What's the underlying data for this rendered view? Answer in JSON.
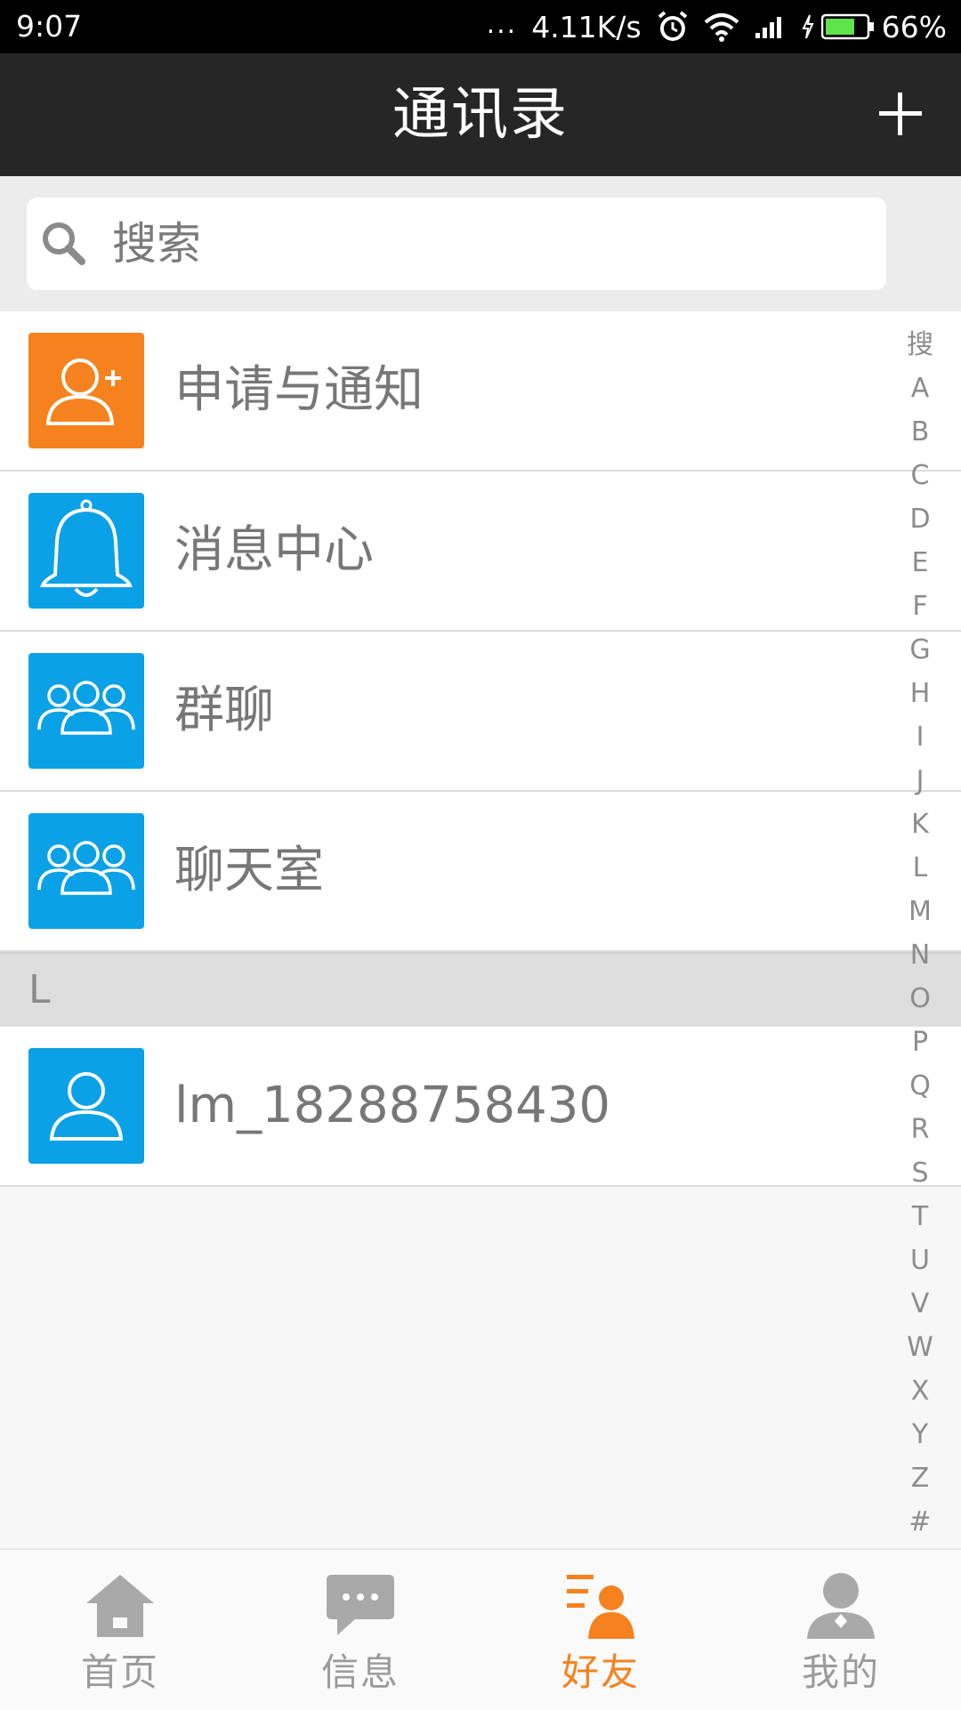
{
  "status_bar": {
    "time": "9:07",
    "dots": "...",
    "speed": "4.11K/s",
    "battery": "66%"
  },
  "header": {
    "title": "通讯录"
  },
  "search": {
    "placeholder": "搜索"
  },
  "list": {
    "items": [
      {
        "label": "申请与通知",
        "icon": "add-user-icon",
        "color": "#f5821f"
      },
      {
        "label": "消息中心",
        "icon": "bell-icon",
        "color": "#0aa1e6"
      },
      {
        "label": "群聊",
        "icon": "group-icon",
        "color": "#0aa1e6"
      },
      {
        "label": "聊天室",
        "icon": "group-icon",
        "color": "#0aa1e6"
      }
    ],
    "section_letter": "L",
    "contact": {
      "label": "lm_18288758430",
      "icon": "user-icon",
      "color": "#0aa1e6"
    }
  },
  "alphabet": [
    "搜",
    "A",
    "B",
    "C",
    "D",
    "E",
    "F",
    "G",
    "H",
    "I",
    "J",
    "K",
    "L",
    "M",
    "N",
    "O",
    "P",
    "Q",
    "R",
    "S",
    "T",
    "U",
    "V",
    "W",
    "X",
    "Y",
    "Z",
    "#"
  ],
  "nav": {
    "tabs": [
      {
        "label": "首页",
        "icon": "home-icon"
      },
      {
        "label": "信息",
        "icon": "message-icon"
      },
      {
        "label": "好友",
        "icon": "friends-icon",
        "active": true
      },
      {
        "label": "我的",
        "icon": "profile-icon"
      }
    ]
  },
  "colors": {
    "accent": "#f5821f",
    "blue": "#0aa1e6",
    "header_bg": "#262626"
  }
}
